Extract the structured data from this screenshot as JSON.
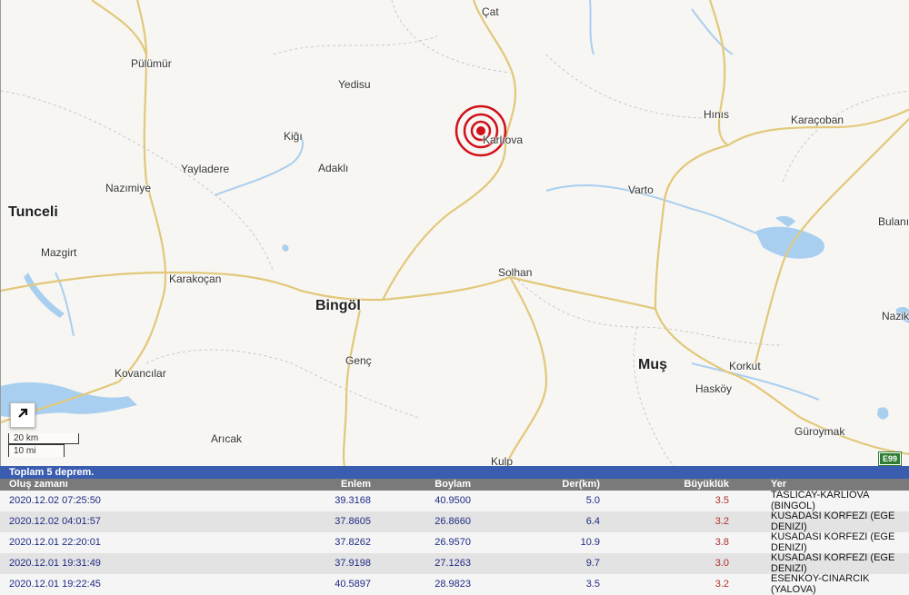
{
  "map": {
    "places": [
      {
        "name": "Çat",
        "big": false
      },
      {
        "name": "Pülümür",
        "big": false
      },
      {
        "name": "Yedisu",
        "big": false
      },
      {
        "name": "Hınıs",
        "big": false
      },
      {
        "name": "Karaçoban",
        "big": false
      },
      {
        "name": "Kiğı",
        "big": false
      },
      {
        "name": "Karlıova",
        "big": false
      },
      {
        "name": "Yayladere",
        "big": false
      },
      {
        "name": "Adaklı",
        "big": false
      },
      {
        "name": "Nazımiye",
        "big": false
      },
      {
        "name": "Varto",
        "big": false
      },
      {
        "name": "Tunceli",
        "big": true
      },
      {
        "name": "Bulanı",
        "big": false
      },
      {
        "name": "Mazgirt",
        "big": false
      },
      {
        "name": "Solhan",
        "big": false
      },
      {
        "name": "Karakoçan",
        "big": false
      },
      {
        "name": "Bingöl",
        "big": true
      },
      {
        "name": "Nazik",
        "big": false
      },
      {
        "name": "Genç",
        "big": false
      },
      {
        "name": "Muş",
        "big": true
      },
      {
        "name": "Korkut",
        "big": false
      },
      {
        "name": "Kovancılar",
        "big": false
      },
      {
        "name": "Hasköy",
        "big": false
      },
      {
        "name": "Güroymak",
        "big": false
      },
      {
        "name": "Arıcak",
        "big": false
      },
      {
        "name": "Kulp",
        "big": false
      }
    ],
    "scale": {
      "km": "20 km",
      "mi": "10 mi"
    },
    "road_shield": "E99",
    "colors": {
      "quake": "#d0101a",
      "road": "#e2c87a",
      "water": "#a9cff0",
      "border": "#c0c0c0"
    }
  },
  "panel": {
    "summary": "Toplam 5 deprem.",
    "headers": [
      "Oluş zamanı",
      "Enlem",
      "Boylam",
      "Der(km)",
      "Büyüklük",
      "Yer"
    ],
    "rows": [
      [
        "2020.12.02 07:25:50",
        "39.3168",
        "40.9500",
        "5.0",
        "3.5",
        "TASLICAY-KARLIOVA (BINGOL)"
      ],
      [
        "2020.12.02 04:01:57",
        "37.8605",
        "26.8660",
        "6.4",
        "3.2",
        "KUSADASI KORFEZI (EGE DENIZI)"
      ],
      [
        "2020.12.01 22:20:01",
        "37.8262",
        "26.9570",
        "10.9",
        "3.8",
        "KUSADASI KORFEZI (EGE DENIZI)"
      ],
      [
        "2020.12.01 19:31:49",
        "37.9198",
        "27.1263",
        "9.7",
        "3.0",
        "KUSADASI KORFEZI (EGE DENIZI)"
      ],
      [
        "2020.12.01 19:22:45",
        "40.5897",
        "28.9823",
        "3.5",
        "3.2",
        "ESENKOY-CINARCIK (YALOVA)"
      ]
    ]
  }
}
